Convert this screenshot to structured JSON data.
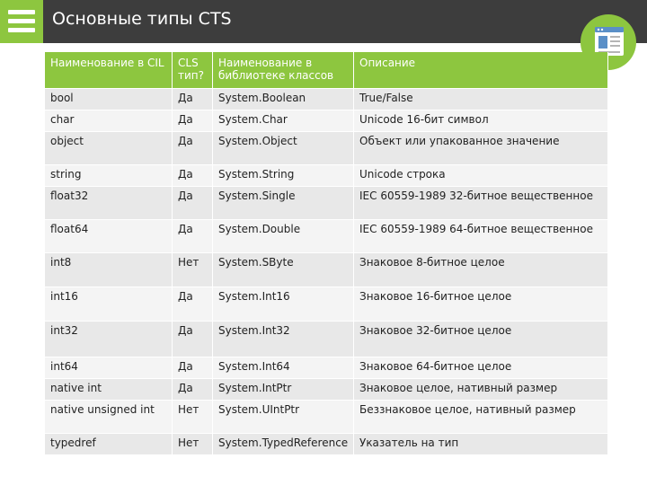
{
  "slide": {
    "title": "Основные типы CTS"
  },
  "icons": {
    "menu": "hamburger-menu-icon",
    "document": "document-window-icon"
  },
  "colors": {
    "accent": "#8dc63f",
    "header": "#3d3d3d"
  },
  "table": {
    "headers": [
      "Наименование в CIL",
      "CLS тип?",
      "Наименование в библиотеке классов",
      "Описание"
    ],
    "rows": [
      [
        "bool",
        "Да",
        "System.Boolean",
        "True/False"
      ],
      [
        "char",
        "Да",
        "System.Char",
        "Unicode 16-бит символ"
      ],
      [
        "object",
        "Да",
        "System.Object",
        "Объект или упакованное значение"
      ],
      [
        "string",
        "Да",
        "System.String",
        "Unicode строка"
      ],
      [
        "float32",
        "Да",
        "System.Single",
        "IEC 60559-1989 32-битное вещественное"
      ],
      [
        "float64",
        "Да",
        "System.Double",
        "IEC 60559-1989 64-битное вещественное"
      ],
      [
        "int8",
        "Нет",
        "System.SByte",
        "Знаковое 8-битное целое"
      ],
      [
        "int16",
        "Да",
        "System.Int16",
        "Знаковое 16-битное целое"
      ],
      [
        "int32",
        "Да",
        "System.Int32",
        "Знаковое 32-битное целое"
      ],
      [
        "int64",
        "Да",
        "System.Int64",
        "Знаковое 64-битное целое"
      ],
      [
        "native int",
        "Да",
        "System.IntPtr",
        "Знаковое целое, нативный размер"
      ],
      [
        "native unsigned int",
        "Нет",
        "System.UIntPtr",
        "Беззнаковое целое, нативный размер"
      ],
      [
        "typedref",
        "Нет",
        "System.TypedReference",
        "Указатель на тип"
      ]
    ]
  }
}
